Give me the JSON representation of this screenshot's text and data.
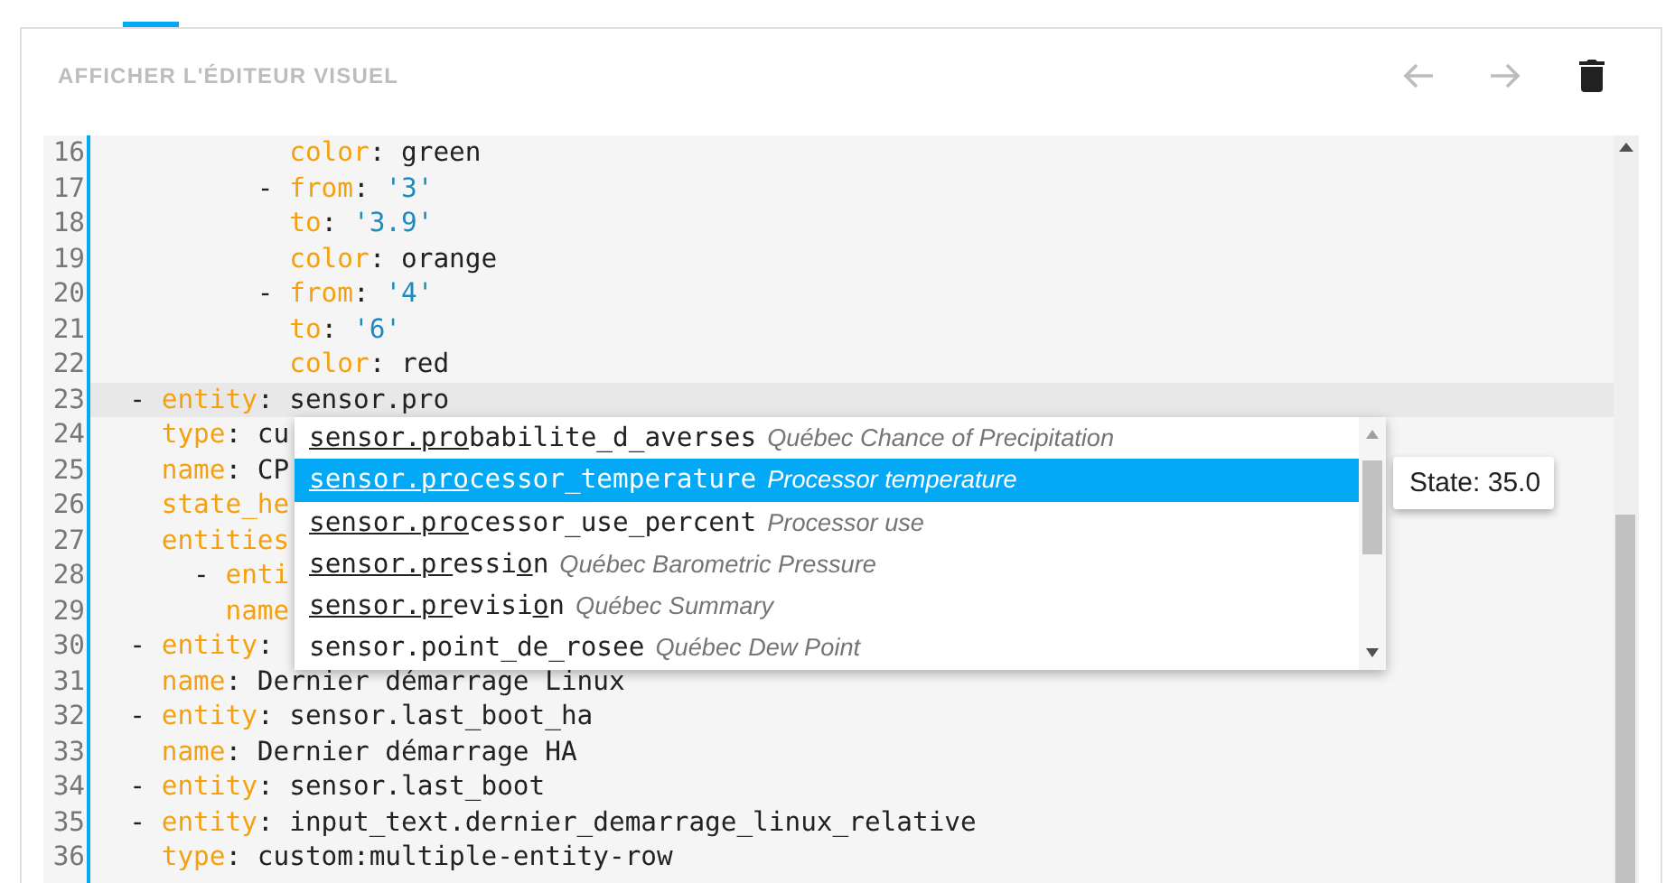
{
  "toolbar": {
    "visual_editor_button": "AFFICHER L'ÉDITEUR VISUEL",
    "undo": {
      "disabled": true
    },
    "redo": {
      "disabled": true
    },
    "delete": {
      "disabled": false
    }
  },
  "editor": {
    "lines": [
      {
        "number": "16",
        "active": false,
        "tokens": [
          {
            "kind": "key",
            "text": "            color"
          },
          {
            "kind": "plain",
            "text": ": green"
          }
        ]
      },
      {
        "number": "17",
        "active": false,
        "tokens": [
          {
            "kind": "plain",
            "text": "          - "
          },
          {
            "kind": "key",
            "text": "from"
          },
          {
            "kind": "plain",
            "text": ": "
          },
          {
            "kind": "string",
            "text": "'3'"
          }
        ]
      },
      {
        "number": "18",
        "active": false,
        "tokens": [
          {
            "kind": "key",
            "text": "            to"
          },
          {
            "kind": "plain",
            "text": ": "
          },
          {
            "kind": "string",
            "text": "'3.9'"
          }
        ]
      },
      {
        "number": "19",
        "active": false,
        "tokens": [
          {
            "kind": "key",
            "text": "            color"
          },
          {
            "kind": "plain",
            "text": ": orange"
          }
        ]
      },
      {
        "number": "20",
        "active": false,
        "tokens": [
          {
            "kind": "plain",
            "text": "          - "
          },
          {
            "kind": "key",
            "text": "from"
          },
          {
            "kind": "plain",
            "text": ": "
          },
          {
            "kind": "string",
            "text": "'4'"
          }
        ]
      },
      {
        "number": "21",
        "active": false,
        "tokens": [
          {
            "kind": "key",
            "text": "            to"
          },
          {
            "kind": "plain",
            "text": ": "
          },
          {
            "kind": "string",
            "text": "'6'"
          }
        ]
      },
      {
        "number": "22",
        "active": false,
        "tokens": [
          {
            "kind": "key",
            "text": "            color"
          },
          {
            "kind": "plain",
            "text": ": red"
          }
        ]
      },
      {
        "number": "23",
        "active": true,
        "tokens": [
          {
            "kind": "plain",
            "text": "  - "
          },
          {
            "kind": "key",
            "text": "entity"
          },
          {
            "kind": "plain",
            "text": ": sensor.pro"
          }
        ]
      },
      {
        "number": "24",
        "active": false,
        "tokens": [
          {
            "kind": "key",
            "text": "    type"
          },
          {
            "kind": "plain",
            "text": ": cu"
          }
        ]
      },
      {
        "number": "25",
        "active": false,
        "tokens": [
          {
            "kind": "key",
            "text": "    name"
          },
          {
            "kind": "plain",
            "text": ": CP"
          }
        ]
      },
      {
        "number": "26",
        "active": false,
        "tokens": [
          {
            "kind": "key",
            "text": "    state_he"
          }
        ]
      },
      {
        "number": "27",
        "active": false,
        "tokens": [
          {
            "kind": "key",
            "text": "    entities"
          }
        ]
      },
      {
        "number": "28",
        "active": false,
        "tokens": [
          {
            "kind": "plain",
            "text": "      - "
          },
          {
            "kind": "key",
            "text": "enti"
          }
        ]
      },
      {
        "number": "29",
        "active": false,
        "tokens": [
          {
            "kind": "key",
            "text": "        name"
          }
        ]
      },
      {
        "number": "30",
        "active": false,
        "tokens": [
          {
            "kind": "plain",
            "text": "  - "
          },
          {
            "kind": "key",
            "text": "entity"
          },
          {
            "kind": "plain",
            "text": ":"
          }
        ]
      },
      {
        "number": "31",
        "active": false,
        "tokens": [
          {
            "kind": "key",
            "text": "    name"
          },
          {
            "kind": "plain",
            "text": ": Dernier démarrage Linux"
          }
        ]
      },
      {
        "number": "32",
        "active": false,
        "tokens": [
          {
            "kind": "plain",
            "text": "  - "
          },
          {
            "kind": "key",
            "text": "entity"
          },
          {
            "kind": "plain",
            "text": ": sensor.last_boot_ha"
          }
        ]
      },
      {
        "number": "33",
        "active": false,
        "tokens": [
          {
            "kind": "key",
            "text": "    name"
          },
          {
            "kind": "plain",
            "text": ": Dernier démarrage HA"
          }
        ]
      },
      {
        "number": "34",
        "active": false,
        "tokens": [
          {
            "kind": "plain",
            "text": "  - "
          },
          {
            "kind": "key",
            "text": "entity"
          },
          {
            "kind": "plain",
            "text": ": sensor.last_boot"
          }
        ]
      },
      {
        "number": "35",
        "active": false,
        "tokens": [
          {
            "kind": "plain",
            "text": "  - "
          },
          {
            "kind": "key",
            "text": "entity"
          },
          {
            "kind": "plain",
            "text": ": input_text.dernier_demarrage_linux_relative"
          }
        ]
      },
      {
        "number": "36",
        "active": false,
        "tokens": [
          {
            "kind": "key",
            "text": "    type"
          },
          {
            "kind": "plain",
            "text": ": custom:multiple-entity-row"
          }
        ]
      }
    ]
  },
  "autocomplete": {
    "items": [
      {
        "selected": false,
        "parts": [
          {
            "text": "sensor.pro",
            "match": true
          },
          {
            "text": "babilite_d_averses",
            "match": false
          }
        ],
        "description": "Québec Chance of Precipitation"
      },
      {
        "selected": true,
        "parts": [
          {
            "text": "sensor.pro",
            "match": true
          },
          {
            "text": "cessor_temperature",
            "match": false
          }
        ],
        "description": "Processor temperature"
      },
      {
        "selected": false,
        "parts": [
          {
            "text": "sensor.pro",
            "match": true
          },
          {
            "text": "cessor_use_percent",
            "match": false
          }
        ],
        "description": "Processor use"
      },
      {
        "selected": false,
        "parts": [
          {
            "text": "sensor.pr",
            "match": true
          },
          {
            "text": "essi",
            "match": false
          },
          {
            "text": "o",
            "match": true
          },
          {
            "text": "n",
            "match": false
          }
        ],
        "description": "Québec Barometric Pressure"
      },
      {
        "selected": false,
        "parts": [
          {
            "text": "sensor.pr",
            "match": true
          },
          {
            "text": "evisi",
            "match": false
          },
          {
            "text": "o",
            "match": true
          },
          {
            "text": "n",
            "match": false
          }
        ],
        "description": "Québec Summary"
      },
      {
        "selected": false,
        "parts": [
          {
            "text": "sensor.point_de_rosee",
            "match": false
          }
        ],
        "description": "Québec Dew Point"
      }
    ]
  },
  "tooltip": {
    "text": "State: 35.0"
  }
}
